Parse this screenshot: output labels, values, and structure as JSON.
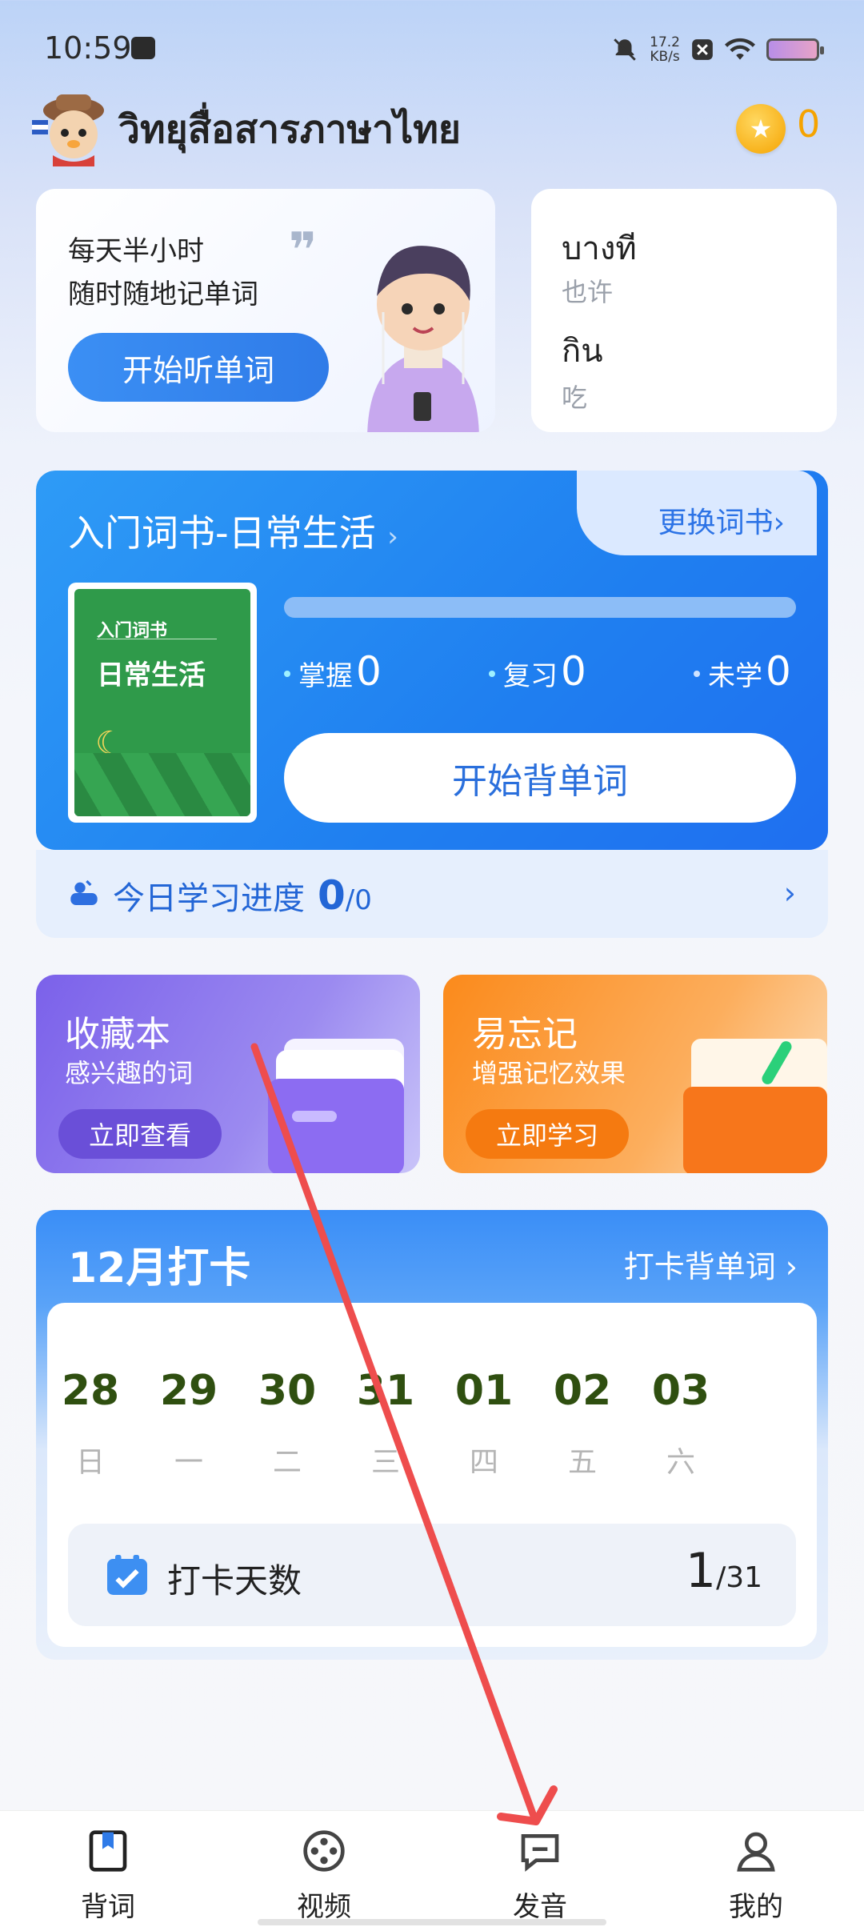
{
  "status_bar": {
    "time": "10:59",
    "speed_value": "17.2",
    "speed_unit": "KB/s"
  },
  "header": {
    "app_title": "วิทยุสื่อสารภาษาไทย",
    "coin_count": "0"
  },
  "listen_card": {
    "line1": "每天半小时",
    "line2": "随时随地记单词",
    "button": "开始听单词"
  },
  "word_card": {
    "words": [
      {
        "thai": "บางที",
        "cn": "也许"
      },
      {
        "thai": "กิน",
        "cn": "吃"
      }
    ]
  },
  "vocab_book": {
    "title": "入门词书-日常生活",
    "title_chevron": "›",
    "change_book": "更换词书",
    "change_chevron": "›",
    "cover_small": "入门词书",
    "cover_big": "日常生活",
    "progress_fraction": 0,
    "stats": [
      {
        "label": "掌握",
        "value": "0"
      },
      {
        "label": "复习",
        "value": "0"
      },
      {
        "label": "未学",
        "value": "0"
      }
    ],
    "start_button": "开始背单词",
    "today_label": "今日学习进度",
    "today_done": "0",
    "today_total": "/0",
    "today_chevron": "›"
  },
  "favorites_card": {
    "title": "收藏本",
    "subtitle": "感兴趣的词",
    "button": "立即查看"
  },
  "forget_card": {
    "title": "易忘记",
    "subtitle": "增强记忆效果",
    "button": "立即学习"
  },
  "checkin": {
    "title": "12月打卡",
    "link": "打卡背单词",
    "link_chevron": "›",
    "days": [
      {
        "num": "28",
        "wd": "日"
      },
      {
        "num": "29",
        "wd": "一"
      },
      {
        "num": "30",
        "wd": "二"
      },
      {
        "num": "31",
        "wd": "三"
      },
      {
        "num": "01",
        "wd": "四"
      },
      {
        "num": "02",
        "wd": "五"
      },
      {
        "num": "03",
        "wd": "六"
      }
    ],
    "days_label": "打卡天数",
    "days_count": "1",
    "days_total": "/31"
  },
  "bottom_nav": {
    "items": [
      {
        "label": "背词",
        "icon": "bookmark-book-icon"
      },
      {
        "label": "视频",
        "icon": "film-reel-icon"
      },
      {
        "label": "发音",
        "icon": "chat-bubble-icon"
      },
      {
        "label": "我的",
        "icon": "person-icon"
      }
    ]
  },
  "colors": {
    "accent_blue": "#2f7be8",
    "coin_orange": "#f5a300",
    "annotation_red": "#ee4d4d"
  }
}
